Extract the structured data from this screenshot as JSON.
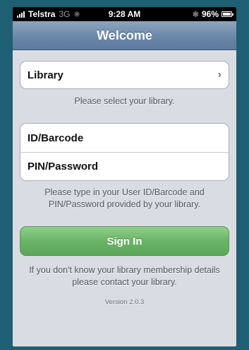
{
  "status_bar": {
    "carrier": "Telstra",
    "network": "3G",
    "time": "9:28 AM",
    "battery": "96%",
    "icons": [
      "signal-icon",
      "activity-spinner-icon",
      "bluetooth-icon",
      "battery-icon"
    ]
  },
  "nav": {
    "title": "Welcome"
  },
  "library": {
    "label": "Library",
    "hint": "Please select your library."
  },
  "credentials": {
    "id_label": "ID/Barcode",
    "pin_label": "PIN/Password",
    "hint": "Please type in your User ID/Barcode and PIN/Password provided by your library."
  },
  "sign_in": {
    "label": "Sign In",
    "color": "#6bb367"
  },
  "help_text": "If you don't know your library membership details please contact your library.",
  "version": "Version 2.0.3",
  "colors": {
    "nav_bar": "#6b87a7",
    "background": "#d9dde3",
    "frame": "#1f5f73"
  }
}
